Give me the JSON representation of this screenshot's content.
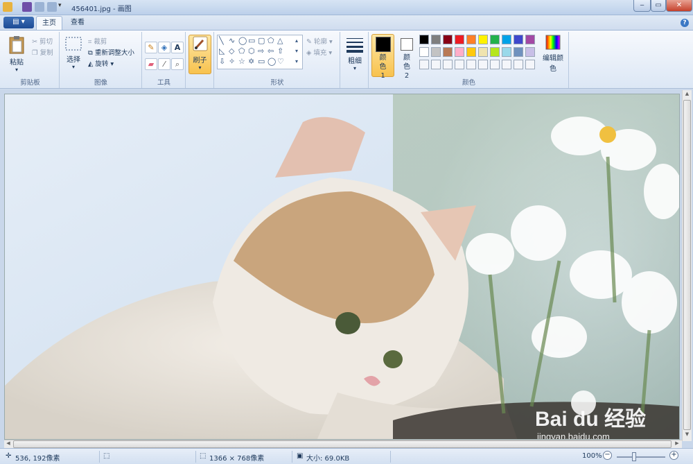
{
  "window": {
    "title": "456401.jpg - 画图",
    "min": "‒",
    "max": "▭",
    "close": "✕"
  },
  "tabs": {
    "file": "▤ ▾",
    "home": "主页",
    "view": "查看"
  },
  "clipboard": {
    "paste": "粘贴",
    "cut": "剪切",
    "copy": "复制",
    "label": "剪贴板"
  },
  "image": {
    "select": "选择",
    "crop": "裁剪",
    "resize": "重新调整大小",
    "rotate": "旋转",
    "label": "图像"
  },
  "tools": {
    "label": "工具"
  },
  "brushes": {
    "label": "刷子"
  },
  "shapes": {
    "outline": "轮廓",
    "fill": "填充",
    "label": "形状"
  },
  "size": {
    "label": "粗细"
  },
  "colors": {
    "color1": "颜色 1",
    "color2": "颜色 2",
    "edit": "编辑颜色",
    "label": "颜色",
    "palette_row1": [
      "#000000",
      "#7f7f7f",
      "#880015",
      "#ed1c24",
      "#ff7f27",
      "#fff200",
      "#22b14c",
      "#00a2e8",
      "#3f48cc",
      "#a349a4"
    ],
    "palette_row2": [
      "#ffffff",
      "#c3c3c3",
      "#b97a57",
      "#ffaec9",
      "#ffc90e",
      "#efe4b0",
      "#b5e61d",
      "#99d9ea",
      "#7092be",
      "#c8bfe7"
    ]
  },
  "watermark": {
    "brand": "Bai du 经验",
    "url": "jingyan.baidu.com"
  },
  "status": {
    "cursor": "536, 192像素",
    "dimensions": "1366 × 768像素",
    "filesize": "大小: 69.0KB",
    "zoom": "100%",
    "zoom_fraction": 0.35
  }
}
